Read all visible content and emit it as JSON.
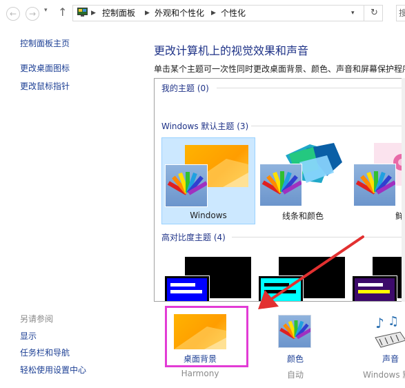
{
  "address_bar": {
    "breadcrumbs": [
      "控制面板",
      "外观和个性化",
      "个性化"
    ],
    "search_placeholder": "搜"
  },
  "sidebar": {
    "home_link": "控制面板主页",
    "links": [
      "更改桌面图标",
      "更改鼠标指针"
    ],
    "see_also_title": "另请参阅",
    "see_also_links": [
      "显示",
      "任务栏和导航",
      "轻松使用设置中心"
    ]
  },
  "main": {
    "title": "更改计算机上的视觉效果和声音",
    "description": "单击某个主题可一次性同时更改桌面背景、颜色、声音和屏幕保护程序",
    "my_themes": {
      "label": "我的主题",
      "count": "(0)"
    },
    "default_themes": {
      "label": "Windows 默认主题",
      "count": "(3)",
      "items": [
        "Windows",
        "线条和颜色",
        "鲜花"
      ]
    },
    "high_contrast": {
      "label": "高对比度主题",
      "count": "(4)"
    }
  },
  "bottom": {
    "desktop_background": {
      "label": "桌面背景",
      "value": "Harmony"
    },
    "color": {
      "label": "颜色",
      "value": "自动"
    },
    "sound": {
      "label": "声音",
      "value": "Windows 默"
    }
  },
  "colors": {
    "highlight_border": "#e23bd5",
    "arrow": "#e23030",
    "link": "#1c3f94",
    "selection": "#cce8ff"
  }
}
